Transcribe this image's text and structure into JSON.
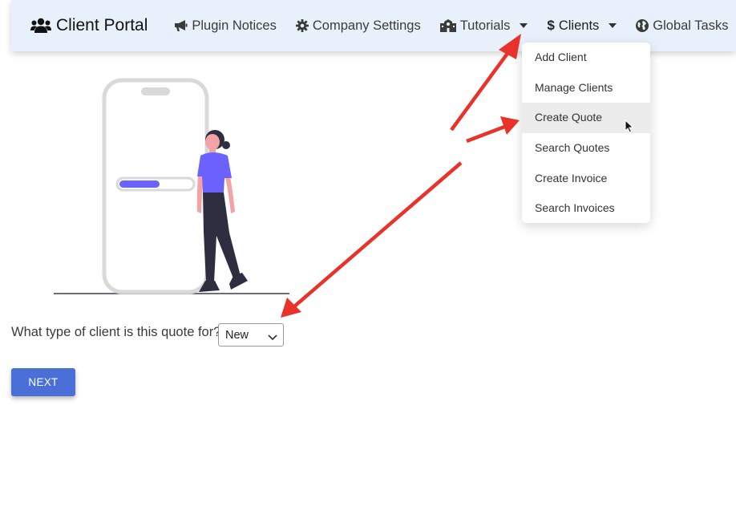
{
  "navbar": {
    "brand": "Client Portal",
    "items": [
      {
        "label": "Plugin Notices",
        "icon": "megaphone-icon",
        "dropdown": false
      },
      {
        "label": "Company Settings",
        "icon": "gear-icon",
        "dropdown": false
      },
      {
        "label": "Tutorials",
        "icon": "school-icon",
        "dropdown": true
      },
      {
        "label": "Clients",
        "icon": "dollar-icon",
        "dropdown": true
      },
      {
        "label": "Global Tasks",
        "icon": "globe-icon",
        "dropdown": false
      }
    ]
  },
  "clients_menu": {
    "items": [
      "Add Client",
      "Manage Clients",
      "Create Quote",
      "Search Quotes",
      "Create Invoice",
      "Search Invoices"
    ],
    "hovered": "Create Quote"
  },
  "form": {
    "question": "What type of client is this quote for?",
    "client_type_value": "New",
    "next_label": "NEXT"
  },
  "colors": {
    "navbar_bg": "#e8f1fb",
    "primary_button": "#4a6fd6",
    "annotation_arrow": "#e8322a",
    "illustration_accent": "#6c63ff"
  }
}
